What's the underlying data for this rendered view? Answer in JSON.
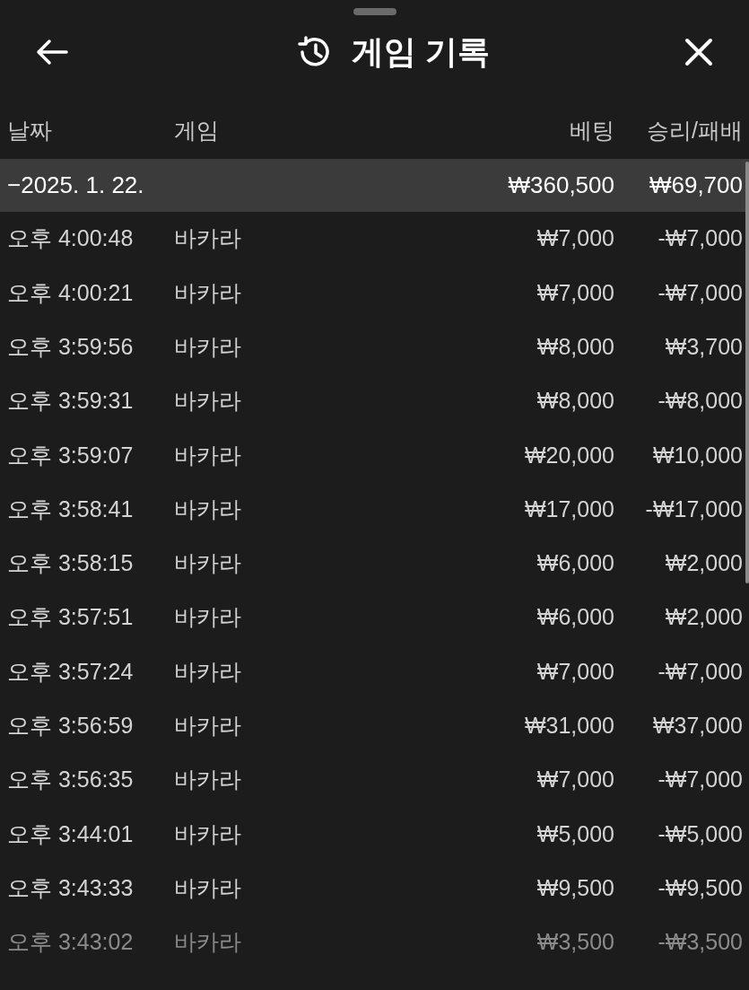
{
  "header": {
    "title": "게임 기록"
  },
  "columns": [
    "날짜",
    "게임",
    "베팅",
    "승리/패배"
  ],
  "group": {
    "date": "−2025. 1. 22.",
    "bet": "₩360,500",
    "result": "₩69,700"
  },
  "rows": [
    {
      "time": "오후 4:00:48",
      "game": "바카라",
      "bet": "₩7,000",
      "result": "-₩7,000"
    },
    {
      "time": "오후 4:00:21",
      "game": "바카라",
      "bet": "₩7,000",
      "result": "-₩7,000"
    },
    {
      "time": "오후 3:59:56",
      "game": "바카라",
      "bet": "₩8,000",
      "result": "₩3,700"
    },
    {
      "time": "오후 3:59:31",
      "game": "바카라",
      "bet": "₩8,000",
      "result": "-₩8,000"
    },
    {
      "time": "오후 3:59:07",
      "game": "바카라",
      "bet": "₩20,000",
      "result": "₩10,000"
    },
    {
      "time": "오후 3:58:41",
      "game": "바카라",
      "bet": "₩17,000",
      "result": "-₩17,000"
    },
    {
      "time": "오후 3:58:15",
      "game": "바카라",
      "bet": "₩6,000",
      "result": "₩2,000"
    },
    {
      "time": "오후 3:57:51",
      "game": "바카라",
      "bet": "₩6,000",
      "result": "₩2,000"
    },
    {
      "time": "오후 3:57:24",
      "game": "바카라",
      "bet": "₩7,000",
      "result": "-₩7,000"
    },
    {
      "time": "오후 3:56:59",
      "game": "바카라",
      "bet": "₩31,000",
      "result": "₩37,000"
    },
    {
      "time": "오후 3:56:35",
      "game": "바카라",
      "bet": "₩7,000",
      "result": "-₩7,000"
    },
    {
      "time": "오후 3:44:01",
      "game": "바카라",
      "bet": "₩5,000",
      "result": "-₩5,000"
    },
    {
      "time": "오후 3:43:33",
      "game": "바카라",
      "bet": "₩9,500",
      "result": "-₩9,500"
    },
    {
      "time": "오후 3:43:02",
      "game": "바카라",
      "bet": "₩3,500",
      "result": "-₩3,500"
    }
  ]
}
